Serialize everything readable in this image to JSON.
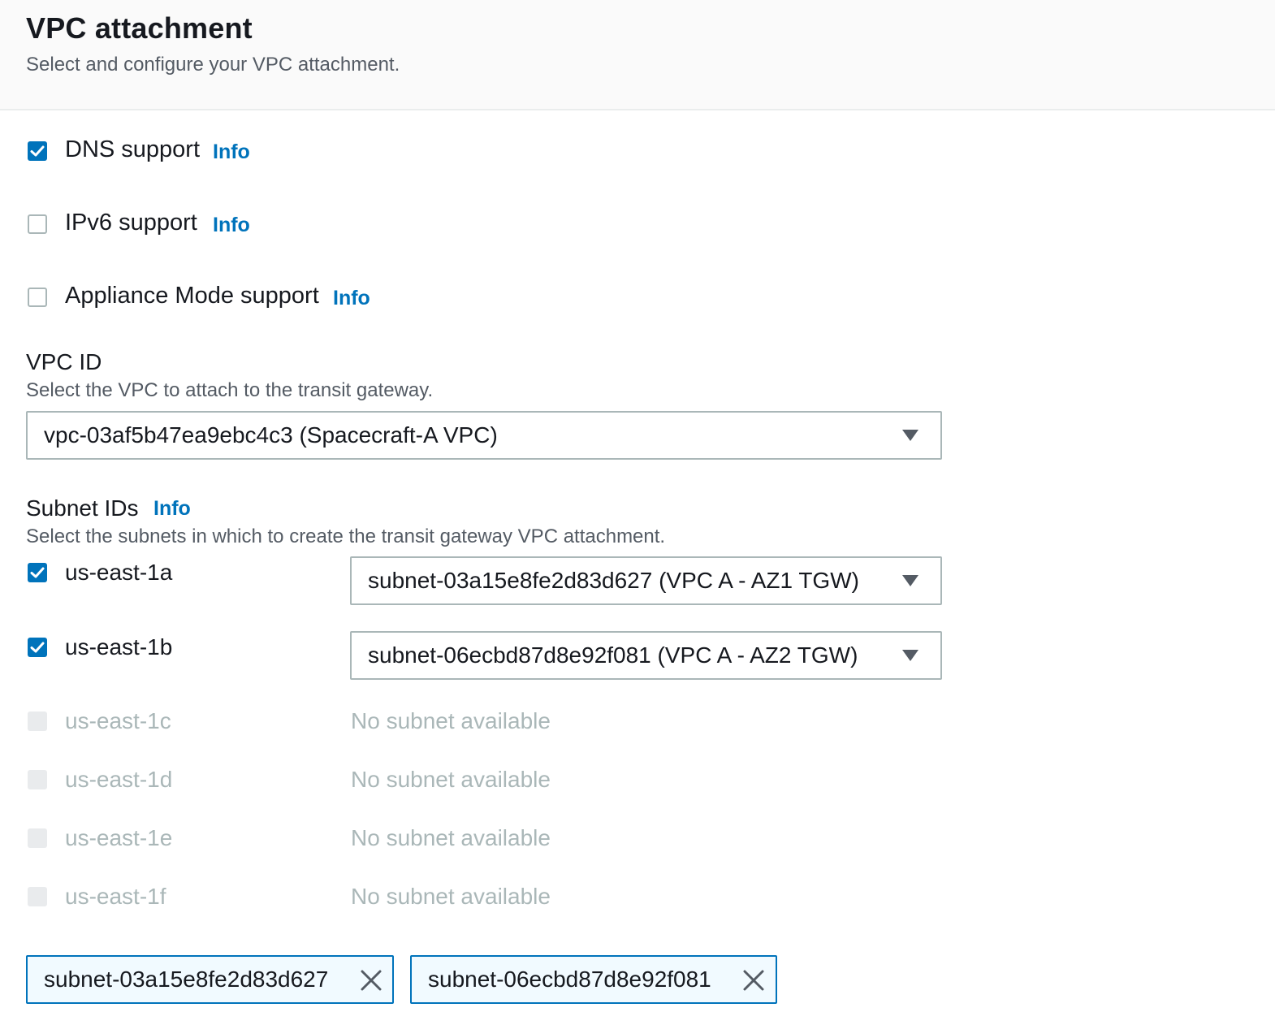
{
  "header": {
    "title": "VPC attachment",
    "description": "Select and configure your VPC attachment."
  },
  "options": {
    "dns": {
      "label": "DNS support",
      "info": "Info",
      "checked": true
    },
    "ipv6": {
      "label": "IPv6 support",
      "info": "Info",
      "checked": false
    },
    "appliance": {
      "label": "Appliance Mode support",
      "info": "Info",
      "checked": false
    }
  },
  "vpc": {
    "label": "VPC ID",
    "description": "Select the VPC to attach to the transit gateway.",
    "value": "vpc-03af5b47ea9ebc4c3 (Spacecraft-A VPC)"
  },
  "subnets": {
    "label": "Subnet IDs",
    "info": "Info",
    "description": "Select the subnets in which to create the transit gateway VPC attachment.",
    "zones": [
      {
        "az": "us-east-1a",
        "checked": true,
        "value": "subnet-03a15e8fe2d83d627 (VPC A - AZ1 TGW)"
      },
      {
        "az": "us-east-1b",
        "checked": true,
        "value": "subnet-06ecbd87d8e92f081 (VPC A - AZ2 TGW)"
      },
      {
        "az": "us-east-1c",
        "checked": false,
        "value": "No subnet available"
      },
      {
        "az": "us-east-1d",
        "checked": false,
        "value": "No subnet available"
      },
      {
        "az": "us-east-1e",
        "checked": false,
        "value": "No subnet available"
      },
      {
        "az": "us-east-1f",
        "checked": false,
        "value": "No subnet available"
      }
    ],
    "tokens": [
      {
        "label": "subnet-03a15e8fe2d83d627",
        "icon": "close-icon"
      },
      {
        "label": "subnet-06ecbd87d8e92f081",
        "icon": "close-icon"
      }
    ]
  },
  "colors": {
    "accent": "#0073bb",
    "text": "#16191f",
    "secondary_text": "#545b64",
    "disabled": "#aab7b8"
  }
}
